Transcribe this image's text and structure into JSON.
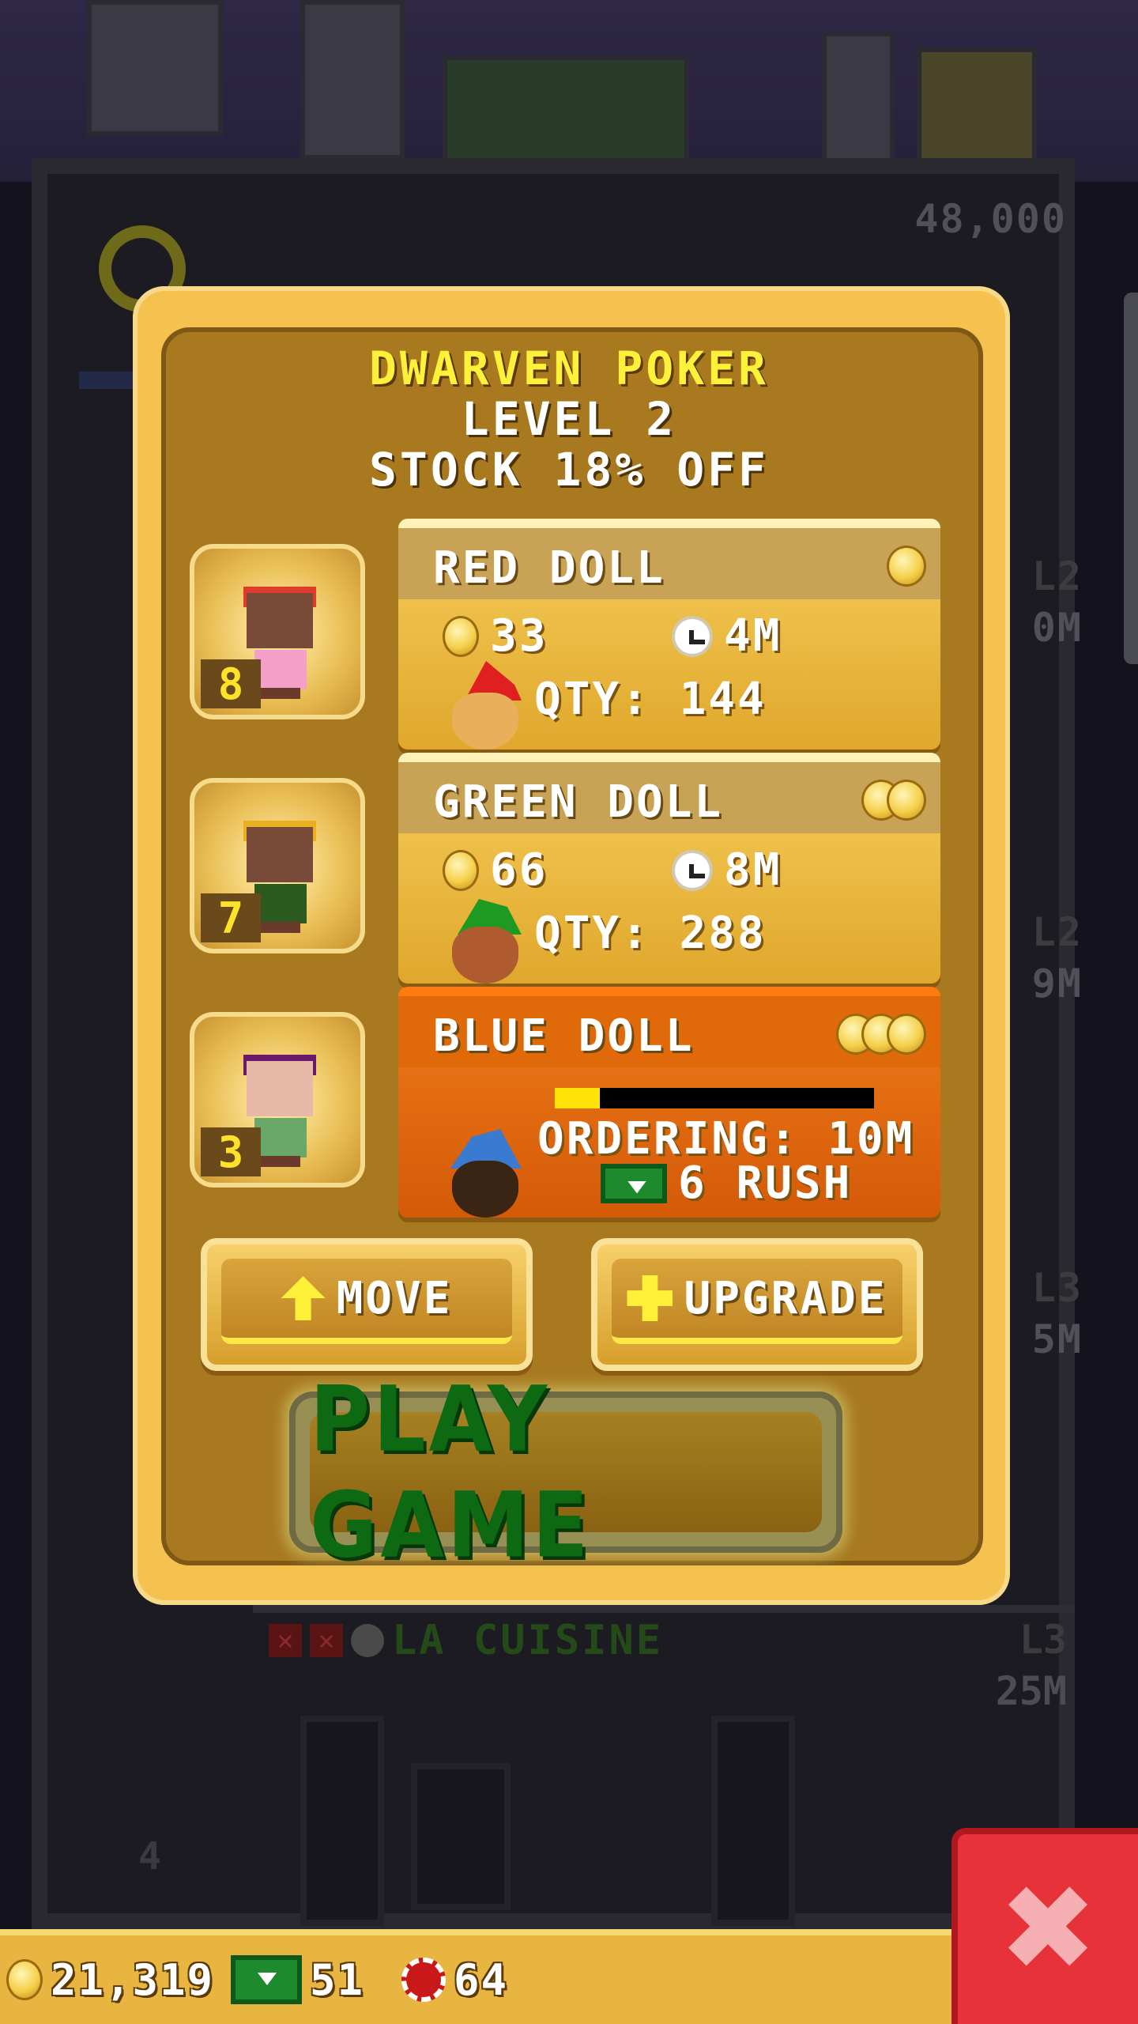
{
  "background": {
    "top_floor_amount": "48,000",
    "floor_levels": [
      "L2",
      "L2",
      "L3"
    ],
    "floor_amounts": [
      "0M",
      "9M",
      "5M"
    ],
    "cuisine": {
      "label": "LA CUISINE",
      "level": "L3",
      "amount": "25M"
    },
    "floor_number": "4"
  },
  "dialog": {
    "title": "DWARVEN POKER",
    "level": "LEVEL 2",
    "stock_note": "STOCK 18% OFF",
    "items": [
      {
        "name": "RED DOLL",
        "tier": 1,
        "price": "33",
        "time": "4M",
        "qty": "QTY: 144",
        "avatar_count": "8",
        "avatar_hair": "#e03a2a",
        "avatar_shirt": "#f4a0c8",
        "dwarf_hat": "#e02020"
      },
      {
        "name": "GREEN DOLL",
        "tier": 2,
        "price": "66",
        "time": "8M",
        "qty": "QTY: 288",
        "avatar_count": "7",
        "avatar_hair": "#e8b020",
        "avatar_shirt": "#2c5a1e",
        "dwarf_hat": "#1e9a22"
      },
      {
        "name": "BLUE DOLL",
        "tier": 3,
        "status": "ORDERING: 10M",
        "rush": "6 RUSH",
        "progress": 0.14,
        "avatar_count": "3",
        "avatar_hair": "#6a1a6a",
        "avatar_shirt": "#6aa86a",
        "dwarf_hat": "#3a7ad0"
      }
    ],
    "buttons": {
      "move": "MOVE",
      "upgrade": "UPGRADE",
      "play": "PLAY GAME"
    }
  },
  "status_bar": {
    "coins": "21,319",
    "bux": "51",
    "chips": "64"
  },
  "colors": {
    "accent_title": "#fff03a",
    "ordering_card": "#e06a0a",
    "play_text": "#0e6a12"
  },
  "icons": {
    "coin": "coin-icon",
    "clock": "clock-icon",
    "bux": "tower-bux-icon",
    "chip": "poker-chip-icon",
    "close": "close-icon",
    "move": "arrow-up-icon",
    "upgrade": "plus-icon"
  }
}
